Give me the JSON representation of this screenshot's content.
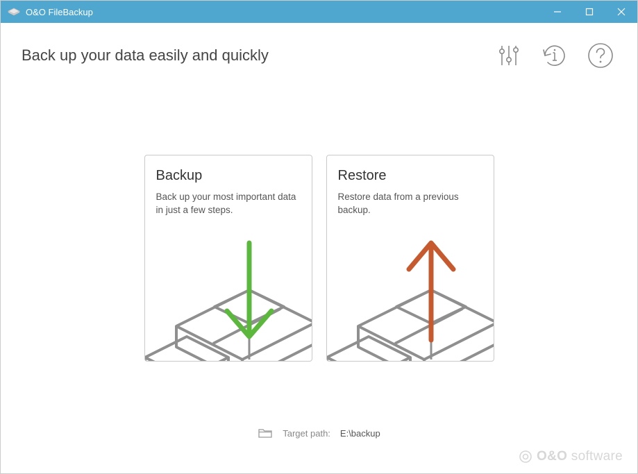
{
  "window": {
    "title": "O&O FileBackup"
  },
  "header": {
    "page_title": "Back up your data easily and quickly"
  },
  "cards": {
    "backup": {
      "title": "Backup",
      "desc": "Back up your most important data in just a few steps."
    },
    "restore": {
      "title": "Restore",
      "desc": "Restore data from a previous backup."
    }
  },
  "target": {
    "label": "Target path:",
    "value": "E:\\backup"
  },
  "brand": {
    "company": "O&O",
    "product": "software"
  },
  "colors": {
    "titlebar": "#4fa6cf",
    "backup_arrow": "#5cb83c",
    "restore_arrow": "#c65a2e",
    "icon_stroke": "#888"
  }
}
